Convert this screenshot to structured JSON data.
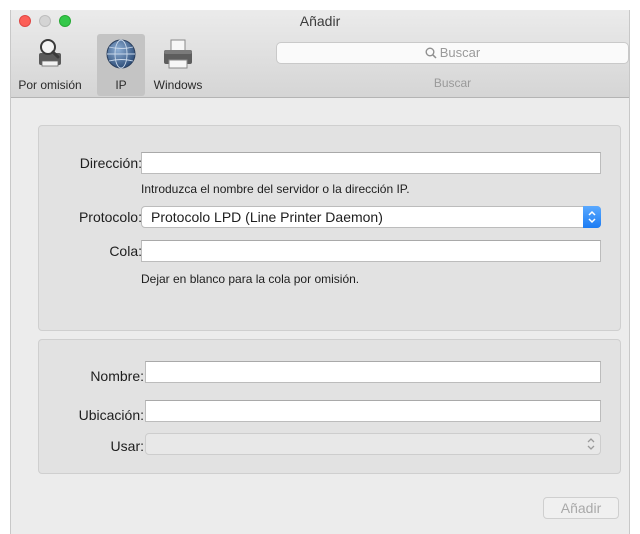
{
  "window": {
    "title": "Añadir"
  },
  "toolbar": {
    "default_label": "Por omisión",
    "ip_label": "IP",
    "windows_label": "Windows",
    "search_placeholder": "Buscar",
    "search_caption": "Buscar"
  },
  "connection": {
    "address_label": "Dirección:",
    "address_value": "",
    "address_hint": "Introduzca el nombre del servidor o la dirección IP.",
    "protocol_label": "Protocolo:",
    "protocol_value": "Protocolo LPD (Line Printer Daemon)",
    "queue_label": "Cola:",
    "queue_value": "",
    "queue_hint": "Dejar en blanco para la cola por omisión."
  },
  "details": {
    "name_label": "Nombre:",
    "name_value": "",
    "location_label": "Ubicación:",
    "location_value": "",
    "use_label": "Usar:",
    "use_value": ""
  },
  "footer": {
    "add_label": "Añadir"
  },
  "colors": {
    "accent": "#1c7cf3",
    "close": "#fc5f57",
    "maximize": "#34c84a"
  }
}
